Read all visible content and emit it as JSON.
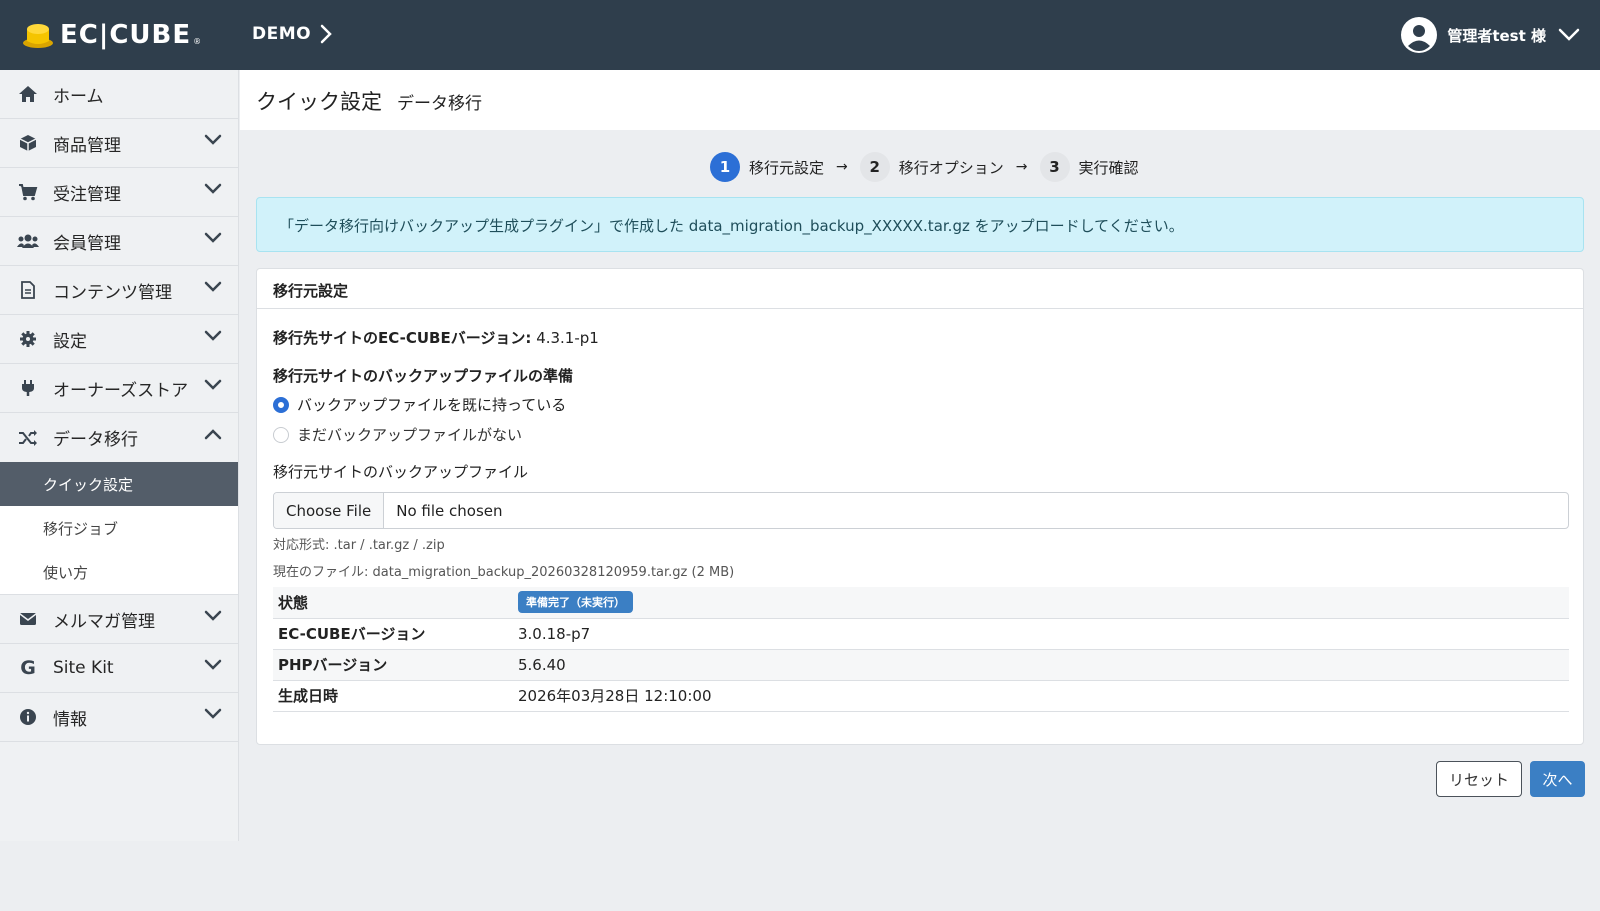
{
  "header": {
    "logo_text": "EC|CUBE",
    "shop_name": "DEMO",
    "user_name": "管理者test 様"
  },
  "sidebar": {
    "items": [
      {
        "label": "ホーム",
        "icon": "home-icon"
      },
      {
        "label": "商品管理",
        "icon": "box-icon"
      },
      {
        "label": "受注管理",
        "icon": "cart-icon"
      },
      {
        "label": "会員管理",
        "icon": "users-icon"
      },
      {
        "label": "コンテンツ管理",
        "icon": "file-icon"
      },
      {
        "label": "設定",
        "icon": "gear-icon"
      },
      {
        "label": "オーナーズストア",
        "icon": "plug-icon"
      },
      {
        "label": "データ移行",
        "icon": "shuffle-icon"
      },
      {
        "label": "メルマガ管理",
        "icon": "mail-icon"
      },
      {
        "label": "Site Kit",
        "icon": "google-icon"
      },
      {
        "label": "情報",
        "icon": "info-icon"
      }
    ],
    "sub_items": [
      {
        "label": "クイック設定",
        "active": true
      },
      {
        "label": "移行ジョブ",
        "active": false
      },
      {
        "label": "使い方",
        "active": false
      }
    ]
  },
  "page": {
    "title": "クイック設定",
    "subtitle": "データ移行"
  },
  "stepper": [
    {
      "num": "1",
      "label": "移行元設定",
      "active": true
    },
    {
      "num": "2",
      "label": "移行オプション",
      "active": false
    },
    {
      "num": "3",
      "label": "実行確認",
      "active": false
    }
  ],
  "stepper_arrow": "→",
  "alert": "「データ移行向けバックアップ生成プラグイン」で作成した data_migration_backup_XXXXX.tar.gz をアップロードしてください。",
  "card": {
    "title": "移行元設定",
    "version_label": "移行先サイトのEC-CUBEバージョン:",
    "version_value": "4.3.1-p1",
    "prep_label": "移行元サイトのバックアップファイルの準備",
    "radio_options": [
      {
        "label": "バックアップファイルを既に持っている",
        "checked": true
      },
      {
        "label": "まだバックアップファイルがない",
        "checked": false
      }
    ],
    "file_label": "移行元サイトのバックアップファイル",
    "file_button": "Choose File",
    "file_none": "No file chosen",
    "formats_hint": "対応形式: .tar / .tar.gz / .zip",
    "current_file": "現在のファイル: data_migration_backup_20260328120959.tar.gz (2 MB)",
    "table": {
      "status_label": "状態",
      "status_badge": "準備完了（未実行）",
      "rows": [
        {
          "key": "EC-CUBEバージョン",
          "value": "3.0.18-p7"
        },
        {
          "key": "PHPバージョン",
          "value": "5.6.40"
        },
        {
          "key": "生成日時",
          "value": "2026年03月28日 12:10:00"
        }
      ]
    }
  },
  "buttons": {
    "reset": "リセット",
    "next": "次へ"
  },
  "colors": {
    "header_bg": "#2f3e4c",
    "primary": "#2c6fd6",
    "button_blue": "#3b7fc4",
    "alert_bg": "#d1f2fa",
    "active_sub_bg": "#535d69"
  }
}
